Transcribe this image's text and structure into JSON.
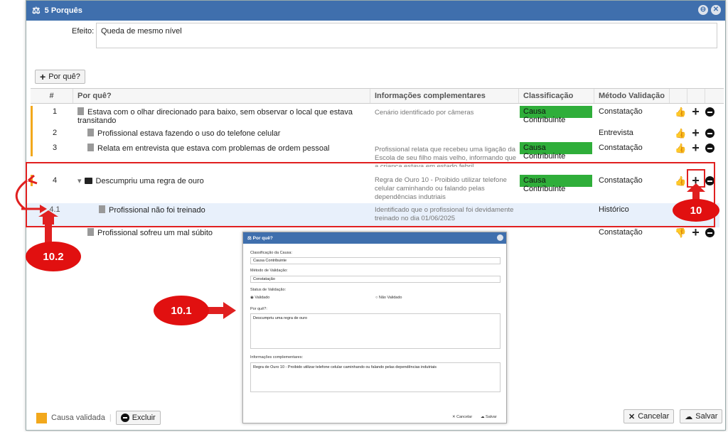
{
  "window": {
    "title": "5 Porquês"
  },
  "efeito": {
    "label": "Efeito:",
    "value": "Queda de mesmo nível"
  },
  "toolbar": {
    "add_label": "Por quê?"
  },
  "grid": {
    "headers": [
      "#",
      "Por quê?",
      "Informações complementares",
      "Classificação",
      "Método Validação"
    ],
    "rows": [
      {
        "num": "1",
        "why": "Estava com o olhar direcionado para baixo, sem observar o local que estava transitando",
        "info": "Cenário identificado por câmeras",
        "class": "Causa Contribuinte",
        "metodo": "Constatação"
      },
      {
        "num": "2",
        "why": "Profissional estava fazendo o uso do telefone celular",
        "info": "",
        "class": "",
        "metodo": "Entrevista"
      },
      {
        "num": "3",
        "why": "Relata em entrevista que estava com problemas de ordem pessoal",
        "info": "Profissional relata que recebeu uma ligação da Escola de seu filho mais velho, informando que a criança estava em estado febril",
        "class": "Causa Contribuinte",
        "metodo": "Constatação"
      },
      {
        "num": "4",
        "why": "Descumpriu uma regra de ouro",
        "info": "Regra de Ouro 10 - Proibido utilizar telefone celular caminhando ou falando pelas dependências indutriais",
        "class": "Causa Contribuinte",
        "metodo": "Constatação"
      },
      {
        "num": "4.1",
        "why": "Profissional não foi treinado",
        "info": "Identificado que o profissional foi devidamente treinado no dia 01/06/2025",
        "class": "",
        "metodo": "Histórico"
      },
      {
        "num": "",
        "why": "Profissional sofreu um mal súbito",
        "info": "",
        "class": "",
        "metodo": "Constatação"
      }
    ]
  },
  "footer": {
    "legend": "Causa validada",
    "delete_label": "Excluir",
    "cancel_label": "Cancelar",
    "save_label": "Salvar"
  },
  "dialog": {
    "title": "Por quê?",
    "class_label": "Classificação da Causa:",
    "class_value": "Causa Contribuinte",
    "metodo_label": "Método de Validação:",
    "metodo_value": "Constatação",
    "status_label": "Status de Validação:",
    "validado": "Validado",
    "nao_validado": "Não Validado",
    "why_label": "Por quê?:",
    "why_value": "Descumpriu uma regra de ouro",
    "info_label": "Informações complementares:",
    "info_value": "Regra de Ouro 10 - Proibido utilizar telefone celular caminhando ou falando pelas dependências indutriais",
    "cancel": "Cancelar",
    "save": "Salvar"
  },
  "annotations": {
    "a10": "10",
    "a101": "10.1",
    "a102": "10.2"
  },
  "colors": {
    "accent": "#3f6fad",
    "validated": "#f2a81c",
    "classification": "#2fae3a",
    "annotation": "#e11010"
  }
}
